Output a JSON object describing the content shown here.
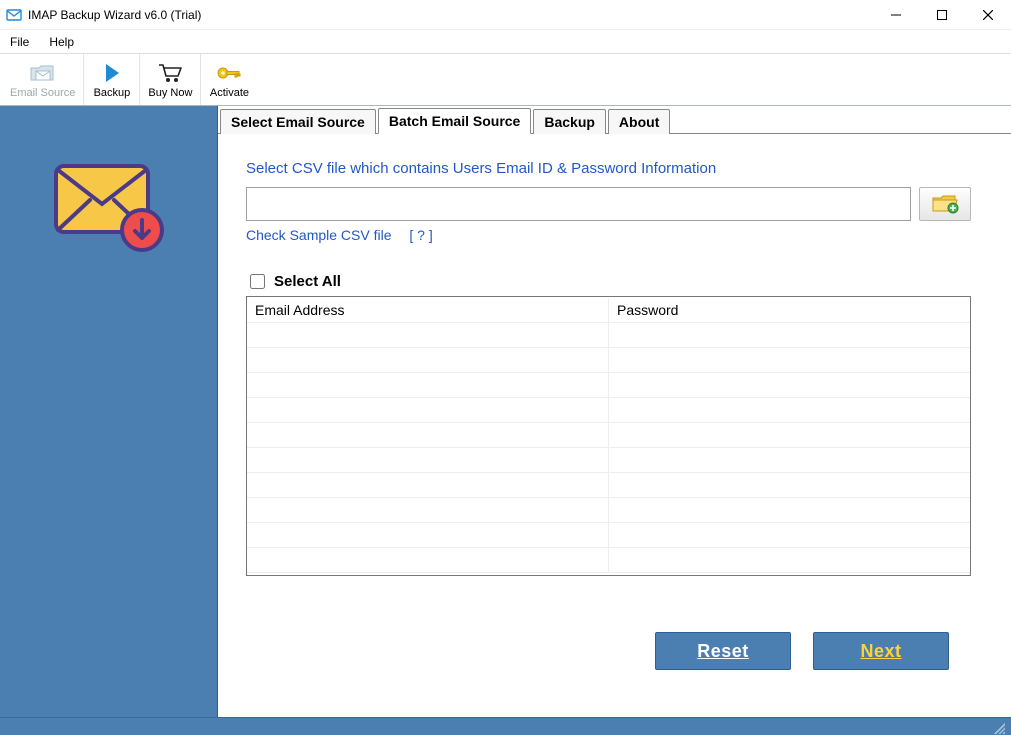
{
  "window": {
    "title": "IMAP Backup Wizard v6.0 (Trial)"
  },
  "menu": {
    "file": "File",
    "help": "Help"
  },
  "toolbar": {
    "email_source": "Email Source",
    "backup": "Backup",
    "buy_now": "Buy Now",
    "activate": "Activate"
  },
  "tabs": {
    "select_email_source": "Select Email Source",
    "batch_email_source": "Batch Email Source",
    "backup": "Backup",
    "about": "About"
  },
  "batch": {
    "instruction": "Select CSV file which contains Users Email ID & Password Information",
    "csv_path": "",
    "check_sample": "Check Sample CSV file",
    "help_marker": "[ ? ]",
    "select_all": "Select All",
    "col_email": "Email Address",
    "col_password": "Password",
    "rows": []
  },
  "actions": {
    "reset": "Reset",
    "next": "Next"
  }
}
